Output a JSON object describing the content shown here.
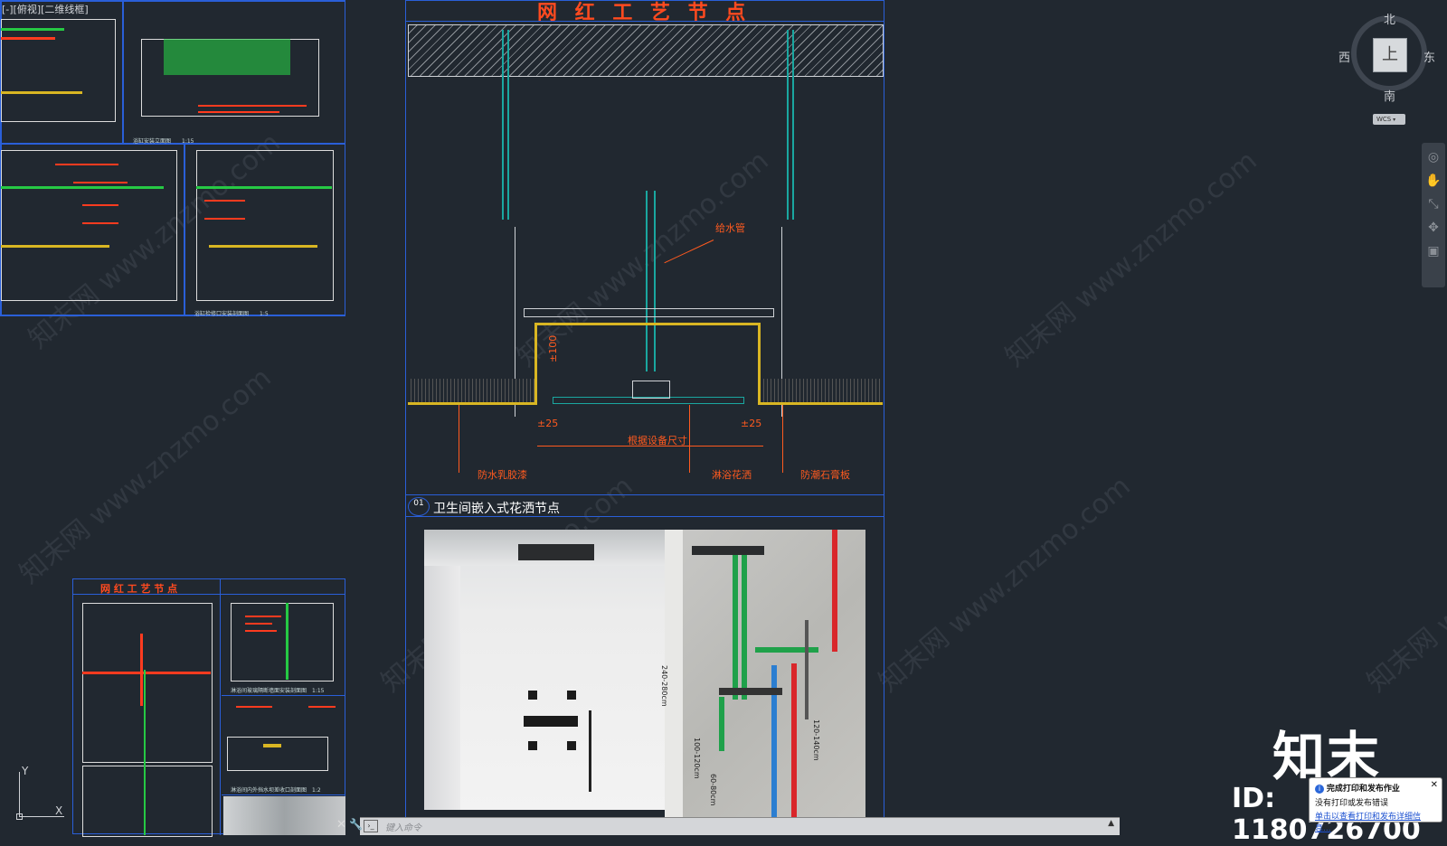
{
  "viewport": {
    "label": "[-][俯视][二维线框]"
  },
  "viewcube": {
    "north": "北",
    "south": "南",
    "east": "东",
    "west": "西",
    "top_face": "上",
    "wcs": "WCS"
  },
  "main_drawing": {
    "title": "网 红 工 艺 节 点",
    "labels": {
      "supply_pipe": "给水管",
      "dimension_100": "±100",
      "dimension_25_left": "±25",
      "dimension_25_right": "±25",
      "per_equipment": "根据设备尺寸",
      "waterproof_paint": "防水乳胶漆",
      "shower_head": "淋浴花洒",
      "moisture_board": "防潮石膏板"
    },
    "node_number": "01",
    "node_title": "卫生间嵌入式花洒节点"
  },
  "top_left": {
    "caption_1": "浴缸安装立面图　　1:15",
    "caption_2": "浴缸检修口安装剖面图　　1:5"
  },
  "bottom_left": {
    "title": "网 红 工 艺 节 点",
    "caption_1": "淋浴间玻璃隔断墙面安装剖面图　1:15",
    "caption_2": "淋浴间内外挡水坝差收口剖面图　1:2"
  },
  "photo_dims": {
    "range_1": "240-280cm",
    "range_2": "100-120cm",
    "range_3": "60-80cm",
    "range_4": "120-140cm"
  },
  "brand": {
    "logo": "知末",
    "id_text": "ID: 1180726700"
  },
  "watermark_text": "知末网 www.znzmo.com",
  "command_line": {
    "placeholder": "键入命令"
  },
  "notification": {
    "title": "完成打印和发布作业",
    "body": "没有打印或发布错误",
    "link": "单击以查看打印和发布详细信息..."
  },
  "ucs": {
    "x": "X",
    "y": "Y"
  }
}
